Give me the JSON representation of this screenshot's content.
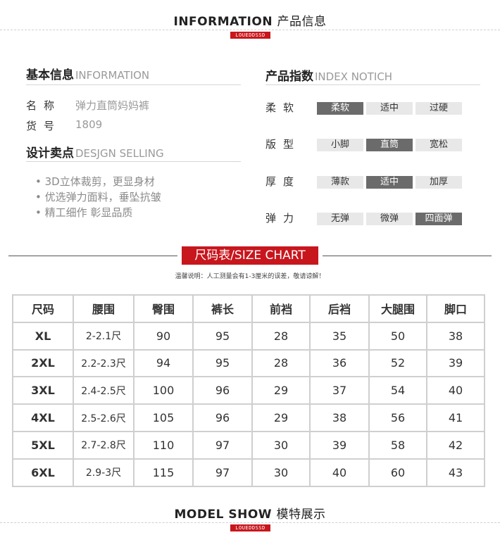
{
  "header_info": {
    "en": "INFORMATION",
    "cn": "产品信息",
    "brand": "LOUEDDSSD"
  },
  "basic": {
    "title_cn": "基本信息",
    "title_en": "INFORMATION",
    "rows": [
      {
        "key": "名称",
        "value": "弹力直筒妈妈裤"
      },
      {
        "key": "货号",
        "value": "1809"
      }
    ]
  },
  "design": {
    "title_cn": "设计卖点",
    "title_en": "DESJGN SELLING",
    "points": [
      "• 3D立体裁剪，更显身材",
      "• 优选弹力面料，垂坠抗皱",
      "• 精工细作 彰显品质"
    ]
  },
  "index": {
    "title_cn": "产品指数",
    "title_en": "INDEX NOTICH",
    "rows": [
      {
        "label": "柔软",
        "options": [
          "柔软",
          "适中",
          "过硬"
        ],
        "selected": 0
      },
      {
        "label": "版型",
        "options": [
          "小脚",
          "直筒",
          "宽松"
        ],
        "selected": 1
      },
      {
        "label": "厚度",
        "options": [
          "薄款",
          "适中",
          "加厚"
        ],
        "selected": 1
      },
      {
        "label": "弹力",
        "options": [
          "无弹",
          "微弹",
          "四面弹"
        ],
        "selected": 2
      }
    ]
  },
  "size_chart": {
    "badge_cn": "尺码表",
    "badge_en": "/SIZE CHART",
    "note": "温馨说明：人工测量会有1-3厘米的误差，敬请谅解！",
    "headers": [
      "尺码",
      "腰围",
      "臀围",
      "裤长",
      "前裆",
      "后裆",
      "大腿围",
      "脚口"
    ],
    "rows": [
      [
        "XL",
        "2-2.1尺",
        "90",
        "95",
        "28",
        "35",
        "50",
        "38"
      ],
      [
        "2XL",
        "2.2-2.3尺",
        "94",
        "95",
        "28",
        "36",
        "52",
        "39"
      ],
      [
        "3XL",
        "2.4-2.5尺",
        "100",
        "96",
        "29",
        "37",
        "54",
        "40"
      ],
      [
        "4XL",
        "2.5-2.6尺",
        "105",
        "96",
        "29",
        "38",
        "56",
        "41"
      ],
      [
        "5XL",
        "2.7-2.8尺",
        "110",
        "97",
        "30",
        "39",
        "58",
        "42"
      ],
      [
        "6XL",
        "2.9-3尺",
        "115",
        "97",
        "30",
        "40",
        "60",
        "43"
      ]
    ]
  },
  "model_show": {
    "en": "MODEL SHOW",
    "cn": "模特展示",
    "brand": "LOUEDDSSD"
  },
  "colors": {
    "accent_red": "#c8161d",
    "selected_gray": "#6b6b6b",
    "option_gray": "#e8e8e8"
  }
}
